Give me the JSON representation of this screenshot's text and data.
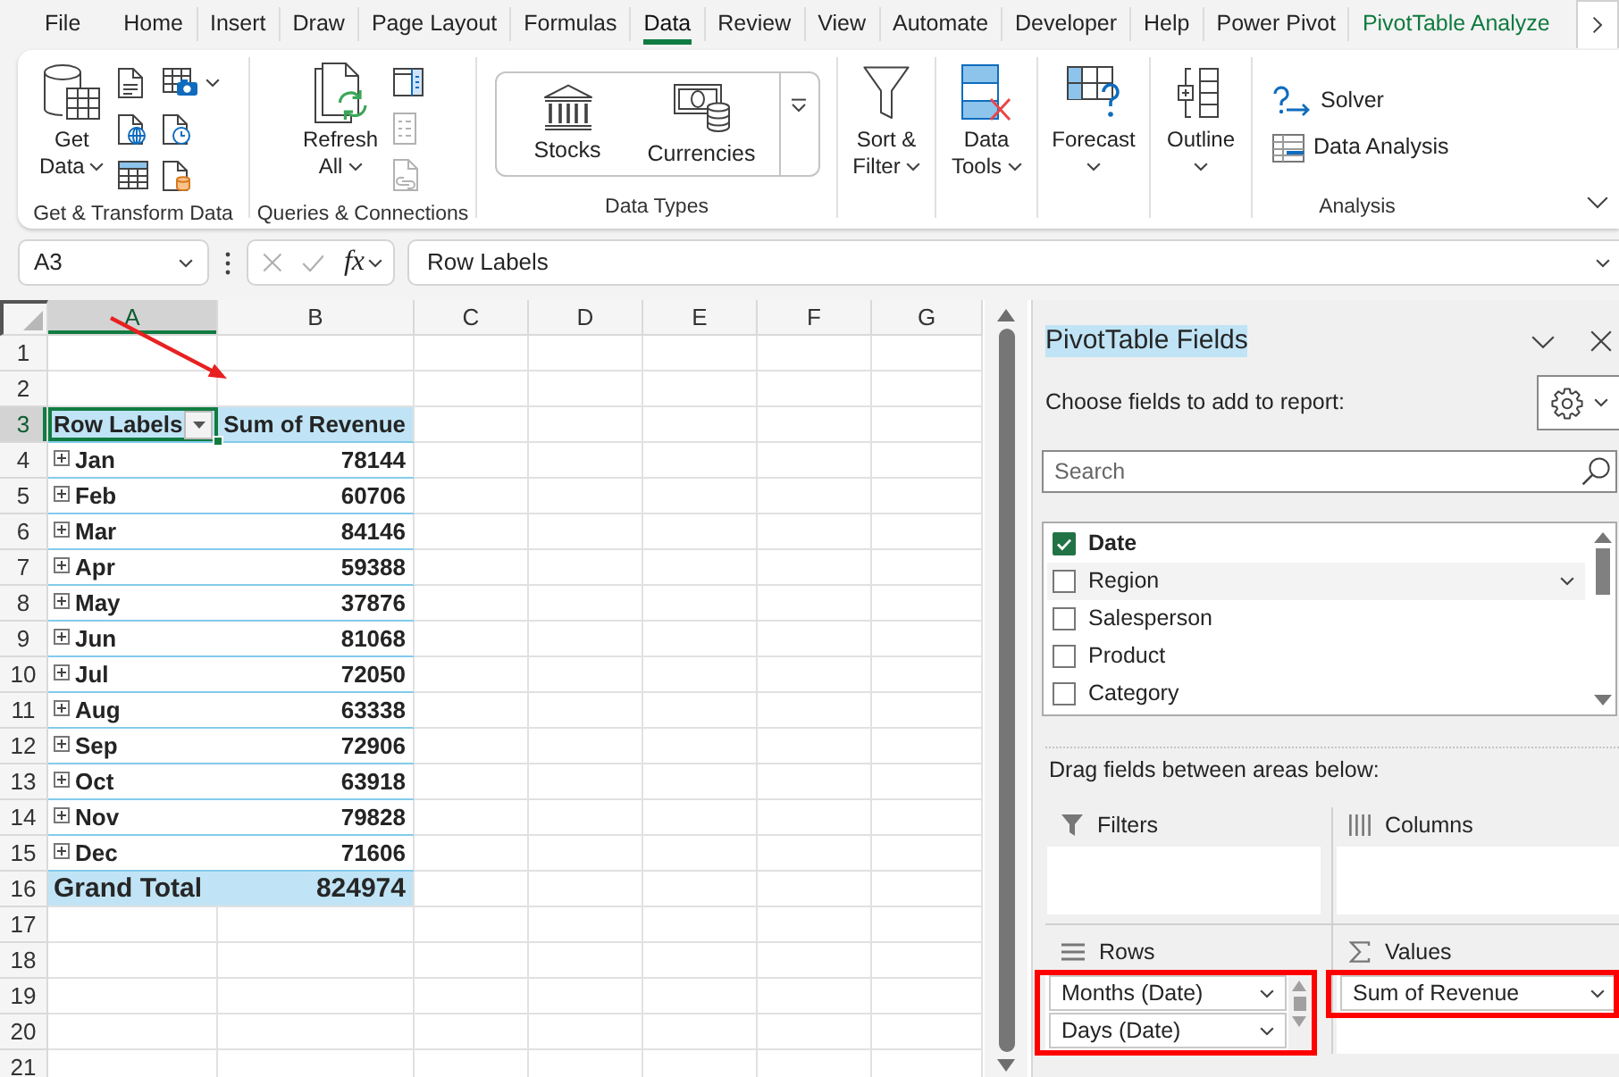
{
  "ribbon_tabs": [
    {
      "label": "File",
      "kind": "standard",
      "selected": false
    },
    {
      "label": "Home",
      "kind": "standard",
      "selected": false
    },
    {
      "label": "Insert",
      "kind": "standard",
      "selected": false
    },
    {
      "label": "Draw",
      "kind": "standard",
      "selected": false
    },
    {
      "label": "Page Layout",
      "kind": "standard",
      "selected": false
    },
    {
      "label": "Formulas",
      "kind": "standard",
      "selected": false
    },
    {
      "label": "Data",
      "kind": "standard",
      "selected": true
    },
    {
      "label": "Review",
      "kind": "standard",
      "selected": false
    },
    {
      "label": "View",
      "kind": "standard",
      "selected": false
    },
    {
      "label": "Automate",
      "kind": "standard",
      "selected": false
    },
    {
      "label": "Developer",
      "kind": "standard",
      "selected": false
    },
    {
      "label": "Help",
      "kind": "standard",
      "selected": false
    },
    {
      "label": "Power Pivot",
      "kind": "standard",
      "selected": false
    },
    {
      "label": "PivotTable Analyze",
      "kind": "contextual",
      "selected": false
    }
  ],
  "ribbon_groups": [
    {
      "label": "Get & Transform Data",
      "commands": [
        {
          "kind": "large",
          "lines": [
            "Get",
            "Data"
          ],
          "dropdown": true
        },
        {
          "kind": "small",
          "dropdown": false,
          "disabled": false
        },
        {
          "kind": "small",
          "dropdown": false,
          "disabled": false
        },
        {
          "kind": "small",
          "dropdown": false,
          "disabled": false
        },
        {
          "kind": "small",
          "dropdown": true,
          "disabled": false
        },
        {
          "kind": "small",
          "dropdown": false,
          "disabled": false
        },
        {
          "kind": "small",
          "dropdown": false,
          "disabled": false
        }
      ]
    },
    {
      "label": "Queries & Connections",
      "commands": [
        {
          "kind": "large",
          "lines": [
            "Refresh",
            "All"
          ],
          "dropdown": true
        },
        {
          "kind": "small",
          "dropdown": false,
          "disabled": false
        },
        {
          "kind": "small",
          "dropdown": false,
          "disabled": true
        },
        {
          "kind": "small",
          "dropdown": false,
          "disabled": true
        }
      ]
    },
    {
      "label": "Data Types",
      "commands": [
        {
          "kind": "gallery",
          "items": [
            "Stocks",
            "Currencies"
          ]
        }
      ]
    },
    {
      "commands": [
        {
          "kind": "large",
          "lines": [
            "Sort &",
            "Filter"
          ],
          "dropdown": true
        }
      ]
    },
    {
      "commands": [
        {
          "kind": "large",
          "lines": [
            "Data",
            "Tools"
          ],
          "dropdown": true
        }
      ]
    },
    {
      "commands": [
        {
          "kind": "large",
          "lines": [
            "Forecast"
          ],
          "dropdown": true
        }
      ]
    },
    {
      "commands": [
        {
          "kind": "large",
          "lines": [
            "Outline"
          ],
          "dropdown": true
        }
      ]
    },
    {
      "label": "Analysis",
      "commands": [
        {
          "kind": "labeled",
          "label": "Solver"
        },
        {
          "kind": "labeled",
          "label": "Data Analysis"
        }
      ]
    }
  ],
  "formula_bar": {
    "name_box": "A3",
    "function_symbol": "fx",
    "formula": "Row Labels"
  },
  "sheet": {
    "columns": [
      {
        "label": "A",
        "selected": true
      },
      {
        "label": "B",
        "selected": false
      },
      {
        "label": "C",
        "selected": false
      },
      {
        "label": "D",
        "selected": false
      },
      {
        "label": "E",
        "selected": false
      },
      {
        "label": "F",
        "selected": false
      },
      {
        "label": "G",
        "selected": false
      }
    ],
    "rows": [
      {
        "label": "1",
        "selected": false
      },
      {
        "label": "2",
        "selected": false
      },
      {
        "label": "3",
        "selected": true
      },
      {
        "label": "4",
        "selected": false
      },
      {
        "label": "5",
        "selected": false
      },
      {
        "label": "6",
        "selected": false
      },
      {
        "label": "7",
        "selected": false
      },
      {
        "label": "8",
        "selected": false
      },
      {
        "label": "9",
        "selected": false
      },
      {
        "label": "10",
        "selected": false
      },
      {
        "label": "11",
        "selected": false
      },
      {
        "label": "12",
        "selected": false
      },
      {
        "label": "13",
        "selected": false
      },
      {
        "label": "14",
        "selected": false
      },
      {
        "label": "15",
        "selected": false
      },
      {
        "label": "16",
        "selected": false
      },
      {
        "label": "17",
        "selected": false
      },
      {
        "label": "18",
        "selected": false
      },
      {
        "label": "19",
        "selected": false
      },
      {
        "label": "20",
        "selected": false
      },
      {
        "label": "21",
        "selected": false
      }
    ],
    "pivot": {
      "row_labels_heading": "Row Labels",
      "values_heading": "Sum of Revenue",
      "items": [
        {
          "label": "Jan",
          "value": "78144",
          "expanded": false
        },
        {
          "label": "Feb",
          "value": "60706",
          "expanded": false
        },
        {
          "label": "Mar",
          "value": "84146",
          "expanded": false
        },
        {
          "label": "Apr",
          "value": "59388",
          "expanded": false
        },
        {
          "label": "May",
          "value": "37876",
          "expanded": false
        },
        {
          "label": "Jun",
          "value": "81068",
          "expanded": false
        },
        {
          "label": "Jul",
          "value": "72050",
          "expanded": false
        },
        {
          "label": "Aug",
          "value": "63338",
          "expanded": false
        },
        {
          "label": "Sep",
          "value": "72906",
          "expanded": false
        },
        {
          "label": "Oct",
          "value": "63918",
          "expanded": false
        },
        {
          "label": "Nov",
          "value": "79828",
          "expanded": false
        },
        {
          "label": "Dec",
          "value": "71606",
          "expanded": false
        }
      ],
      "grand_total": {
        "label": "Grand Total",
        "value": "824974"
      }
    }
  },
  "pivot_pane": {
    "title": "PivotTable Fields",
    "subtitle": "Choose fields to add to report:",
    "search": {
      "placeholder": "Search"
    },
    "fields": [
      {
        "label": "Date",
        "checked": true,
        "hovered": false
      },
      {
        "label": "Region",
        "checked": false,
        "hovered": true
      },
      {
        "label": "Salesperson",
        "checked": false,
        "hovered": false
      },
      {
        "label": "Product",
        "checked": false,
        "hovered": false
      },
      {
        "label": "Category",
        "checked": false,
        "hovered": false
      }
    ],
    "areas_hint": "Drag fields between areas below:",
    "areas": [
      {
        "kind": "filters",
        "label": "Filters",
        "highlighted": false
      },
      {
        "kind": "columns",
        "label": "Columns",
        "highlighted": false
      },
      {
        "kind": "rows",
        "label": "Rows",
        "highlighted": true,
        "items": [
          "Months (Date)",
          "Days (Date)"
        ]
      },
      {
        "kind": "values",
        "label": "Values",
        "highlighted": true,
        "items": [
          "Sum of Revenue"
        ]
      }
    ]
  }
}
